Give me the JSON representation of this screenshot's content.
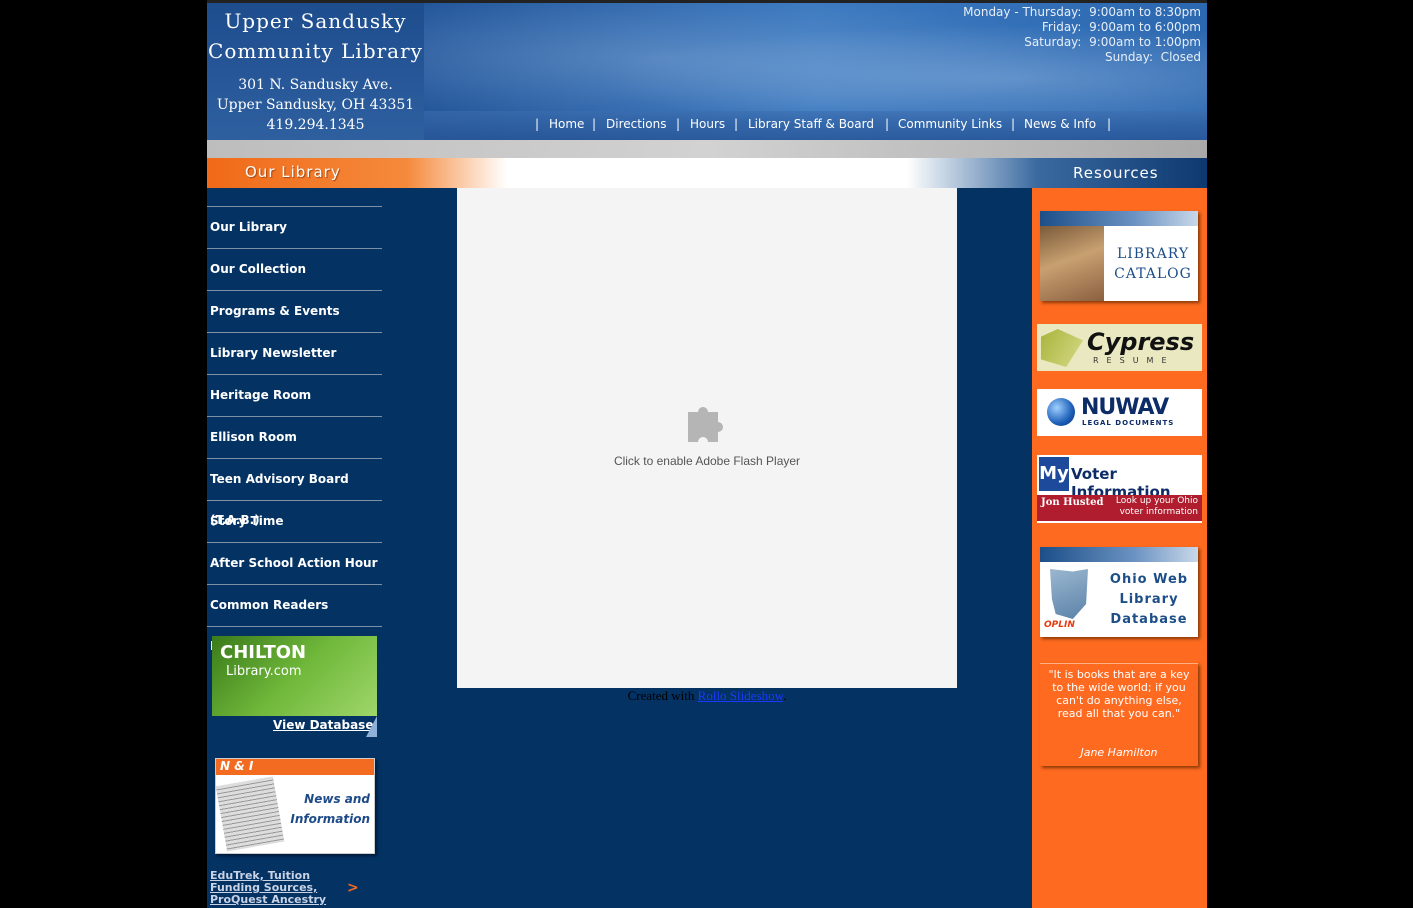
{
  "header": {
    "name_line1": "Upper Sandusky",
    "name_line2": "Community Library",
    "address_line1": "301 N. Sandusky Ave.",
    "address_line2": "Upper Sandusky, OH 43351",
    "phone": "419.294.1345",
    "hours": [
      "Monday - Thursday:  9:00am to 8:30pm",
      "Friday:  9:00am to 6:00pm",
      "Saturday:  9:00am to 1:00pm",
      "Sunday:  Closed"
    ]
  },
  "topnav": {
    "separator": "|",
    "items": [
      "Home",
      "Directions",
      "Hours",
      "Library Staff & Board",
      "Community Links",
      "News & Info"
    ]
  },
  "sections": {
    "left": "Our Library",
    "right": "Resources"
  },
  "sidebar": {
    "items": [
      "Our Library",
      "Our Collection",
      "Programs & Events",
      "Library Newsletter",
      "Heritage Room",
      "Ellison Room",
      "Teen Advisory Board (T.A.B.)",
      "Story Time",
      "After School Action Hour",
      "Common Readers Discussion"
    ],
    "chilton": {
      "title": "CHILTON",
      "subtitle": "Library.com",
      "link": "View Database"
    },
    "news": {
      "tag": "N & I",
      "line1": "News and",
      "line2": "Information"
    },
    "edutrek": {
      "line1": "EduTrek, Tuition",
      "line2": "Funding Sources,",
      "line3": "ProQuest Ancestry",
      "arrow": ">"
    }
  },
  "main": {
    "flash_message": "Click to enable Adobe Flash Player",
    "flash_icon": "puzzle-piece-icon",
    "created_prefix": "Created with",
    "created_link": "Rollo Slideshow",
    "created_suffix": "."
  },
  "resources": {
    "catalog": {
      "line1": "LIBRARY",
      "line2": "CATALOG"
    },
    "cypress": {
      "title": "Cypress",
      "subtitle": "RESUME"
    },
    "nuwav": {
      "title": "NUWAV",
      "subtitle": "LEGAL DOCUMENTS"
    },
    "voter": {
      "my": "My",
      "title": "Voter Information",
      "name": "Jon Husted",
      "look_line1": "Look up your Ohio",
      "look_line2": "voter information"
    },
    "oplin": {
      "line1": "Ohio Web",
      "line2": "Library",
      "line3": "Database",
      "label": "OPLIN"
    },
    "quote": {
      "text": "\"It is books that are a key to the wide world; if you can't do anything else, read all that you can.\"",
      "author": "Jane Hamilton"
    }
  },
  "colors": {
    "page_bg": "#000000",
    "content_bg": "#033263",
    "accent_orange": "#fd6a20",
    "header_blue": "#2a65ad"
  }
}
